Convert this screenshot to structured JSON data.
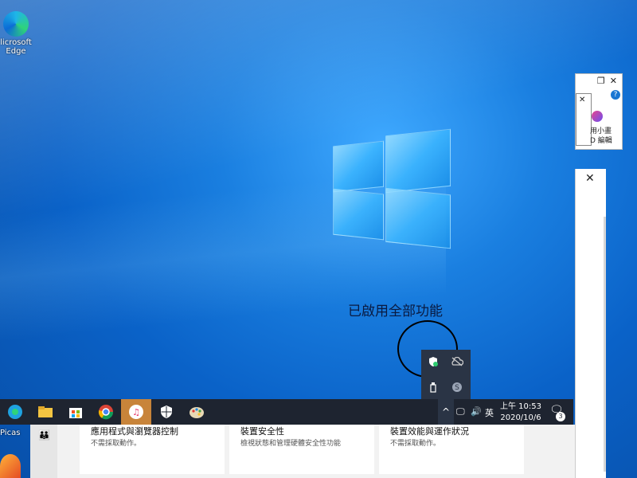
{
  "desktop": {
    "edge_icon_label": "Microsoft Edge",
    "edge_label_line1": "licrosoft",
    "edge_label_line2": "Edge",
    "picasa_label": "Picas"
  },
  "annotation_text": "已啟用全部功能",
  "small_window": {
    "close": "✕",
    "restore": "❐",
    "help": "?",
    "label_line1": "用小畫",
    "label_line2": "D 編輯"
  },
  "tall_window": {
    "close": "✕"
  },
  "tray_popup": {
    "items": [
      "defender-icon",
      "onedrive-offline-icon",
      "usb-icon",
      "skype-icon"
    ]
  },
  "taskbar": {
    "pinned": [
      "edge",
      "file-explorer",
      "microsoft-store",
      "chrome",
      "itunes",
      "windows-security",
      "paint"
    ],
    "tray_up": "^",
    "network_icon": "network-icon",
    "volume_icon": "volume-icon",
    "ime": "英",
    "clock_time": "上午 10:53",
    "clock_date": "2020/10/6",
    "notification_count": "3"
  },
  "security_panel": {
    "cards": [
      {
        "title": "應用程式與瀏覽器控制",
        "subtitle": "不需採取動作。"
      },
      {
        "title": "裝置安全性",
        "subtitle": "檢視狀態和管理硬體安全性功能"
      },
      {
        "title": "裝置效能與運作狀況",
        "subtitle": "不需採取動作。"
      }
    ]
  }
}
